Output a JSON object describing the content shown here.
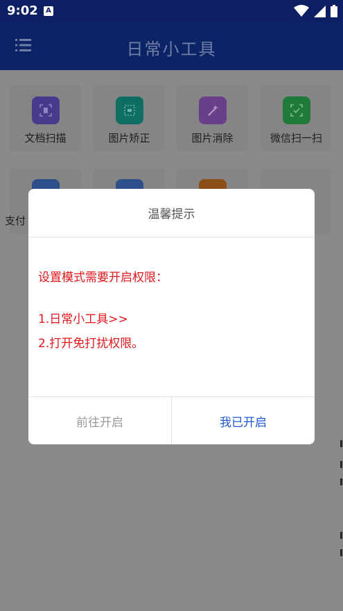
{
  "status_bar": {
    "time": "9:02",
    "app_icon_letter": "A"
  },
  "app_bar": {
    "title": "日常小工具"
  },
  "tools": [
    {
      "label": "文档扫描",
      "icon": "document-scan-icon",
      "color": "#473a8c"
    },
    {
      "label": "图片矫正",
      "icon": "image-correct-icon",
      "color": "#0f6e62"
    },
    {
      "label": "图片消除",
      "icon": "image-erase-icon",
      "color": "#6a3f8a"
    },
    {
      "label": "微信扫一扫",
      "icon": "wechat-scan-icon",
      "color": "#1f7a3a"
    },
    {
      "label": "支付",
      "icon": "payment-icon",
      "color": "#2d4f8c"
    },
    {
      "label": "",
      "icon": "tool-icon",
      "color": "#2d4f8c"
    },
    {
      "label": "",
      "icon": "tool-icon",
      "color": "#8a4e16"
    }
  ],
  "dialog": {
    "title": "温馨提示",
    "message_heading": "设置模式需要开启权限：",
    "steps": [
      "1.日常小工具>>",
      "2.打开免打扰权限。"
    ],
    "cancel_label": "前往开启",
    "confirm_label": "我已开启"
  },
  "colors": {
    "app_bar": "#0c2366",
    "message_text": "#e5161b",
    "confirm_text": "#1e5ad6"
  }
}
